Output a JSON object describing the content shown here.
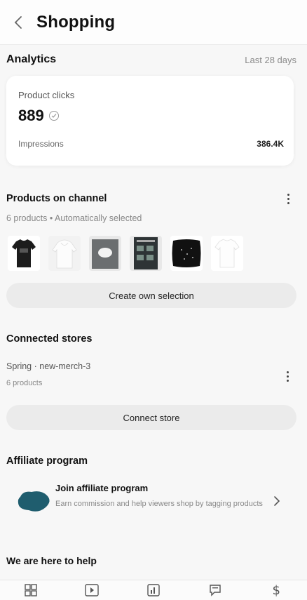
{
  "header": {
    "title": "Shopping",
    "back_icon": "chevron-left-icon"
  },
  "analytics": {
    "title": "Analytics",
    "range": "Last 28 days",
    "card": {
      "clicks_label": "Product clicks",
      "clicks_value": "889",
      "impressions_label": "Impressions",
      "impressions_value": "386.4K"
    }
  },
  "products": {
    "title": "Products on channel",
    "subtitle": "6 products • Automatically selected",
    "items": [
      {
        "name": "black-tshirt"
      },
      {
        "name": "white-hoodie"
      },
      {
        "name": "grey-poster"
      },
      {
        "name": "dark-poster"
      },
      {
        "name": "black-pillow"
      },
      {
        "name": "white-tshirt"
      }
    ],
    "create_button": "Create own selection"
  },
  "stores": {
    "title": "Connected stores",
    "store_name": "Spring · new-merch-3",
    "store_count": "6 products",
    "connect_button": "Connect store"
  },
  "affiliate": {
    "title": "Affiliate program",
    "join_title": "Join affiliate program",
    "join_desc": "Earn commission and help viewers shop by tagging products",
    "logo_color": "#1f5d6e"
  },
  "help": {
    "title": "We are here to help"
  },
  "bottom_nav": {
    "items": [
      "dashboard-icon",
      "content-icon",
      "analytics-icon",
      "comments-icon",
      "earn-icon"
    ]
  }
}
